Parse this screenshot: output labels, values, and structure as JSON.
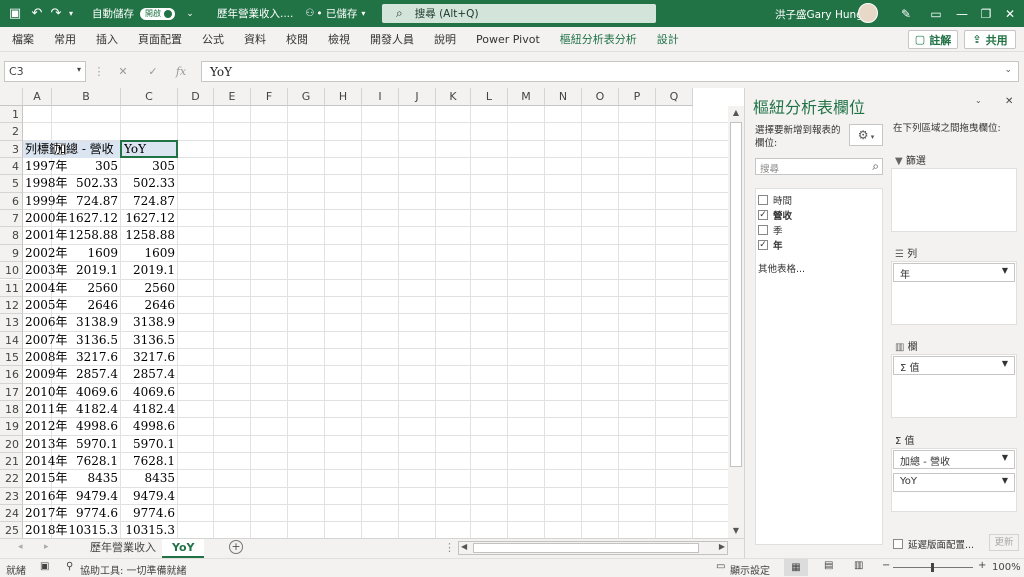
{
  "titlebar": {
    "autosave_label": "自動儲存",
    "autosave_state": "開啟",
    "filename": "歷年營業收入....",
    "save_status": "• 已儲存",
    "search_placeholder": "搜尋 (Alt+Q)",
    "user_name": "洪子盛Gary Hung"
  },
  "ribbon": {
    "tabs": [
      "檔案",
      "常用",
      "插入",
      "頁面配置",
      "公式",
      "資料",
      "校閱",
      "檢視",
      "開發人員",
      "說明",
      "Power Pivot",
      "樞紐分析表分析",
      "設計"
    ],
    "comment_label": "註解",
    "share_label": "共用"
  },
  "formula_bar": {
    "name_box": "C3",
    "fx": "fx",
    "value": "YoY"
  },
  "grid": {
    "columns": [
      "A",
      "B",
      "C",
      "D",
      "E",
      "F",
      "G",
      "H",
      "I",
      "J",
      "K",
      "L",
      "M",
      "N",
      "O",
      "P",
      "Q"
    ],
    "rows": [
      "1",
      "2",
      "3",
      "4",
      "5",
      "6",
      "7",
      "8",
      "9",
      "10",
      "11",
      "12",
      "13",
      "14",
      "15",
      "16",
      "17",
      "18",
      "19",
      "20",
      "21",
      "22",
      "23",
      "24",
      "25"
    ],
    "pivot_headers": [
      "列標籤",
      "加總 - 營收",
      "YoY"
    ],
    "pivot_rows": [
      [
        "1997年",
        "305",
        "305"
      ],
      [
        "1998年",
        "502.33",
        "502.33"
      ],
      [
        "1999年",
        "724.87",
        "724.87"
      ],
      [
        "2000年",
        "1627.12",
        "1627.12"
      ],
      [
        "2001年",
        "1258.88",
        "1258.88"
      ],
      [
        "2002年",
        "1609",
        "1609"
      ],
      [
        "2003年",
        "2019.1",
        "2019.1"
      ],
      [
        "2004年",
        "2560",
        "2560"
      ],
      [
        "2005年",
        "2646",
        "2646"
      ],
      [
        "2006年",
        "3138.9",
        "3138.9"
      ],
      [
        "2007年",
        "3136.5",
        "3136.5"
      ],
      [
        "2008年",
        "3217.6",
        "3217.6"
      ],
      [
        "2009年",
        "2857.4",
        "2857.4"
      ],
      [
        "2010年",
        "4069.6",
        "4069.6"
      ],
      [
        "2011年",
        "4182.4",
        "4182.4"
      ],
      [
        "2012年",
        "4998.6",
        "4998.6"
      ],
      [
        "2013年",
        "5970.1",
        "5970.1"
      ],
      [
        "2014年",
        "7628.1",
        "7628.1"
      ],
      [
        "2015年",
        "8435",
        "8435"
      ],
      [
        "2016年",
        "9479.4",
        "9479.4"
      ],
      [
        "2017年",
        "9774.6",
        "9774.6"
      ],
      [
        "2018年",
        "10315.3",
        "10315.3"
      ]
    ]
  },
  "sheets": {
    "tabs": [
      "歷年營業收入",
      "YoY"
    ],
    "active": "YoY"
  },
  "statusbar": {
    "ready": "就緒",
    "accessibility": "協助工具: 一切準備就緒",
    "display_settings": "顯示設定",
    "zoom": "100%"
  },
  "pane": {
    "title": "樞紐分析表欄位",
    "choose_label": "選擇要新增到報表的欄位:",
    "drag_label": "在下列區域之間拖曳欄位:",
    "search_placeholder": "搜尋",
    "fields": [
      {
        "label": "時間",
        "checked": false
      },
      {
        "label": "營收",
        "checked": true
      },
      {
        "label": "季",
        "checked": false
      },
      {
        "label": "年",
        "checked": true
      }
    ],
    "more_tables": "其他表格...",
    "filters_label": "篩選",
    "rows_label": "列",
    "rows_item": "年",
    "columns_label": "欄",
    "columns_item": "Σ 值",
    "values_label": "Σ 值",
    "values_items": [
      "加總 - 營收",
      "YoY"
    ],
    "defer_label": "延遲版面配置...",
    "update_label": "更新"
  }
}
